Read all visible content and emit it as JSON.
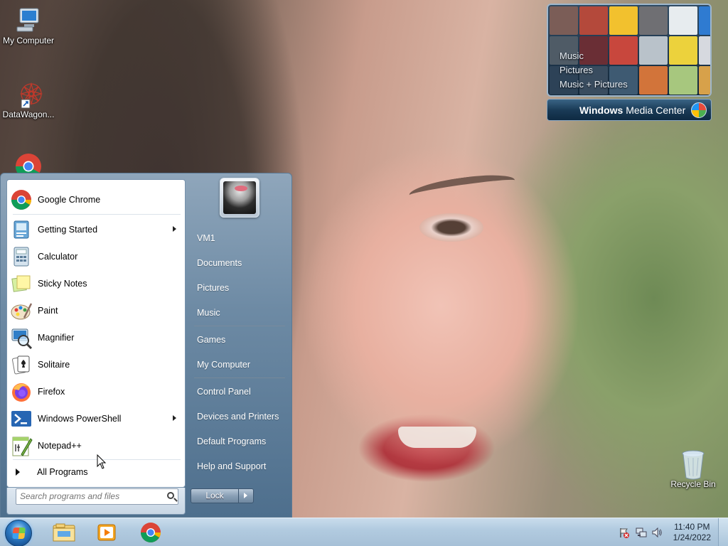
{
  "desktop": {
    "icons": [
      {
        "label": "My Computer",
        "icon": "computer-icon"
      },
      {
        "label": "DataWagon...",
        "icon": "datawagon-shortcut-icon"
      },
      {
        "label": "",
        "icon": "chrome-icon"
      },
      {
        "label": "Recycle Bin",
        "icon": "recycle-bin-icon"
      }
    ]
  },
  "media_center": {
    "menu": [
      "Music",
      "Pictures",
      "Music + Pictures"
    ],
    "brand_bold": "Windows",
    "brand_rest": " Media Center"
  },
  "start_menu": {
    "pinned": {
      "label": "Google Chrome",
      "icon": "chrome-icon"
    },
    "programs": [
      {
        "label": "Getting Started",
        "icon": "getting-started-icon",
        "submenu": true
      },
      {
        "label": "Calculator",
        "icon": "calculator-icon",
        "submenu": false
      },
      {
        "label": "Sticky Notes",
        "icon": "sticky-notes-icon",
        "submenu": false
      },
      {
        "label": "Paint",
        "icon": "paint-icon",
        "submenu": false
      },
      {
        "label": "Magnifier",
        "icon": "magnifier-icon",
        "submenu": false
      },
      {
        "label": "Solitaire",
        "icon": "solitaire-icon",
        "submenu": false
      },
      {
        "label": "Firefox",
        "icon": "firefox-icon",
        "submenu": false
      },
      {
        "label": "Windows PowerShell",
        "icon": "powershell-icon",
        "submenu": true
      },
      {
        "label": "Notepad++",
        "icon": "notepadpp-icon",
        "submenu": false
      }
    ],
    "all_programs": "All Programs",
    "search_placeholder": "Search programs and files",
    "right_links": [
      {
        "label": "VM1"
      },
      {
        "label": "Documents"
      },
      {
        "label": "Pictures"
      },
      {
        "label": "Music"
      },
      {
        "label": "Games"
      },
      {
        "label": "My Computer"
      },
      {
        "label": "Control Panel"
      },
      {
        "label": "Devices and Printers"
      },
      {
        "label": "Default Programs"
      },
      {
        "label": "Help and Support"
      }
    ],
    "lock_label": "Lock"
  },
  "taskbar": {
    "pinned": [
      "explorer-icon",
      "media-player-icon",
      "chrome-icon"
    ],
    "tray": [
      "action-center-flag-icon",
      "network-icon",
      "volume-icon"
    ],
    "time": "11:40 PM",
    "date": "1/24/2022"
  },
  "colors": {
    "start_menu_right": "#6d8aa4",
    "taskbar": "#b2cbe0",
    "accent_blue": "#2f7ec8"
  }
}
